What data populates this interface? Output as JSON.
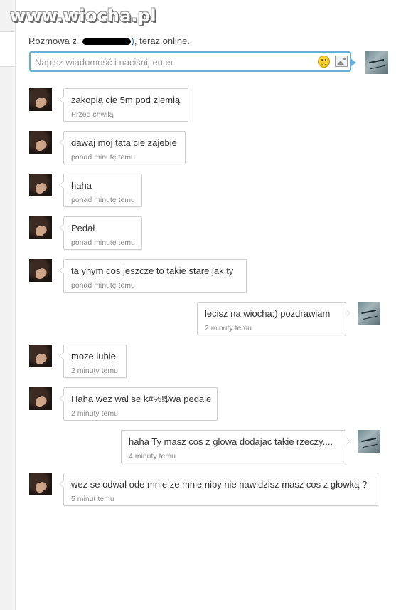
{
  "watermark": "www.wiocha.pl",
  "header": {
    "prefix": "Rozmowa z",
    "name_suffix": ")",
    "status": ", teraz online."
  },
  "composer": {
    "placeholder": "Napisz wiadomość i naciśnij enter.",
    "emoji_icon": "smiley-icon",
    "image_icon": "image-icon"
  },
  "messages": [
    {
      "from": "them",
      "text": "zakopią cie 5m pod ziemią",
      "time": "Przed chwilą"
    },
    {
      "from": "them",
      "text": "dawaj moj tata cie zajebie",
      "time": "ponad minutę temu"
    },
    {
      "from": "them",
      "text": "haha",
      "time": "ponad minutę temu"
    },
    {
      "from": "them",
      "text": "Pedał",
      "time": "ponad minutę temu"
    },
    {
      "from": "them",
      "text": "ta yhym cos jeszcze to takie stare jak ty",
      "time": "ponad minutę temu"
    },
    {
      "from": "me",
      "text": "lecisz na wiocha:) pozdrawiam",
      "time": "2 minuty temu"
    },
    {
      "from": "them",
      "text": "moze lubie",
      "time": "2 minuty temu"
    },
    {
      "from": "them",
      "text": "Haha wez wal se k#%!$wa pedale",
      "time": "2 minuty temu"
    },
    {
      "from": "me",
      "text": "haha Ty masz cos z glowa dodajac takie rzeczy....",
      "time": "4 minuty temu"
    },
    {
      "from": "them",
      "text": "wez se odwal ode mnie ze mnie niby nie nawidzisz masz cos z głowką ?",
      "time": "5 minut temu"
    }
  ]
}
